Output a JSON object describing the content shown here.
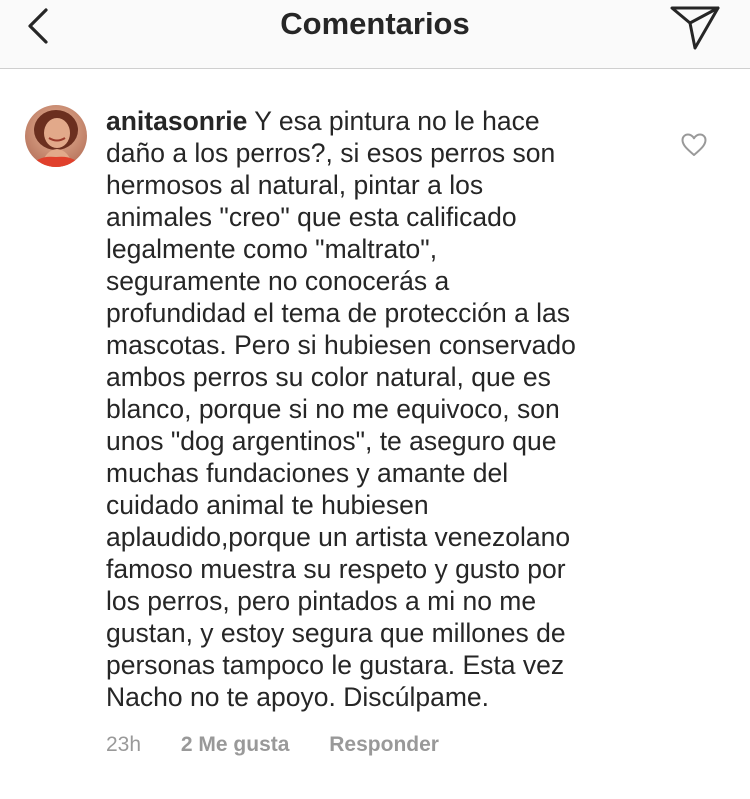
{
  "header": {
    "title": "Comentarios",
    "back_icon": "chevron-left-icon",
    "share_icon": "paper-plane-icon"
  },
  "comment": {
    "username": "anitasonrie",
    "text": " Y esa pintura no le hace\ndaño a los perros?, si esos perros son\nhermosos al natural, pintar a los\nanimales \"creo\" que esta calificado\nlegalmente como \"maltrato\",\nseguramente no conocerás a\nprofundidad el tema  de  protección a las\nmascotas. Pero si hubiesen conservado\nambos perros su color natural, que es\nblanco, porque si no me equivoco, son\nunos \"dog argentinos\", te aseguro que\nmuchas fundaciones y amante del\ncuidado animal te hubiesen\naplaudido,porque un artista venezolano\nfamoso muestra su respeto y gusto por\nlos perros, pero pintados a mi no me\ngustan, y estoy segura que millones de\npersonas tampoco le gustara. Esta vez\nNacho no te apoyo. Discúlpame.",
    "time": "23h",
    "likes": "2 Me gusta",
    "reply_label": "Responder",
    "like_icon": "heart-outline-icon"
  },
  "colors": {
    "text": "#262626",
    "secondary": "#999999",
    "header_bg": "#fafafa",
    "divider": "#cfcfcf"
  }
}
